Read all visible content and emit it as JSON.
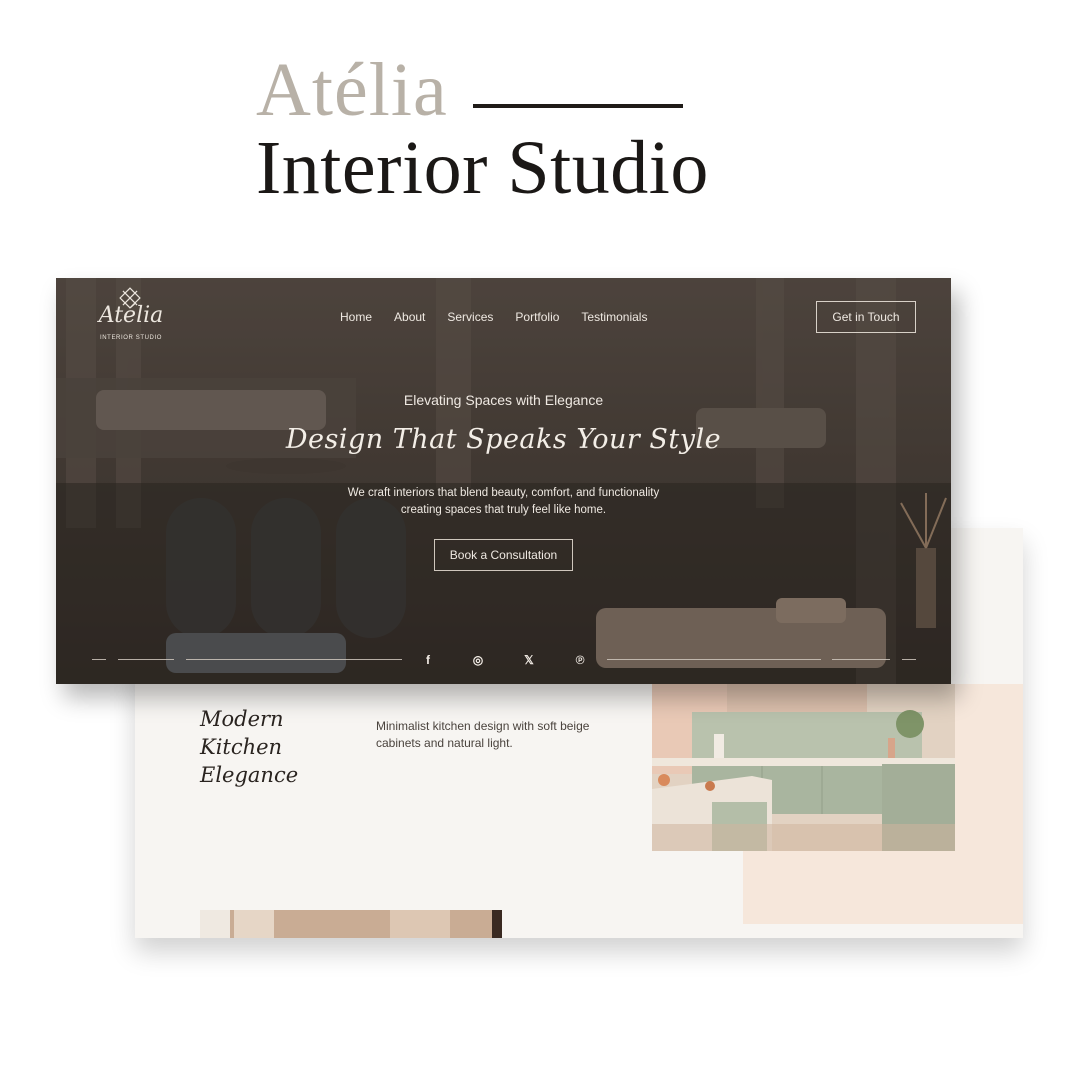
{
  "brand": {
    "title_line_1": "Atélia",
    "title_line_2": "Interior Studio",
    "logo_word": "Atélia",
    "logo_sub": "INTERIOR STUDIO"
  },
  "nav": {
    "items": [
      "Home",
      "About",
      "Services",
      "Portfolio",
      "Testimonials"
    ],
    "cta": "Get in Touch"
  },
  "hero": {
    "kicker": "Elevating Spaces with Elegance",
    "headline": "Design That Speaks Your Style",
    "body_line_1": "We craft interiors that blend beauty, comfort, and functionality",
    "body_line_2": "creating spaces that truly feel like home.",
    "cta": "Book a Consultation"
  },
  "social": {
    "icons": [
      "facebook-icon",
      "instagram-icon",
      "x-icon",
      "pinterest-icon"
    ],
    "glyphs": [
      "f",
      "◎",
      "𝕏",
      "℗"
    ]
  },
  "project": {
    "title_line_1": "Modern Kitchen",
    "title_line_2": "Elegance",
    "description": "Minimalist kitchen design with soft beige cabinets and natural light."
  },
  "colors": {
    "accent_text": "#b8b1a7",
    "dark_text": "#1b1816",
    "hero_overlay": "#3a322c",
    "peach_block": "#f6e7db",
    "page_bg": "#f7f5f2"
  }
}
